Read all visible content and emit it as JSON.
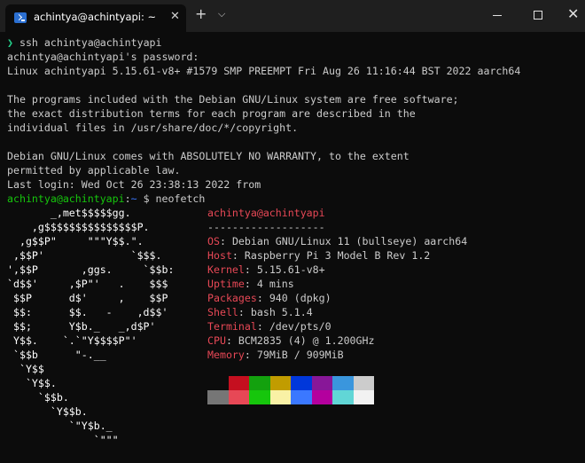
{
  "window": {
    "tab_title": "achintya@achintyapi: ~",
    "tab_close_glyph": "✕",
    "new_tab_glyph": "+",
    "dropdown_glyph": "⌵",
    "close_glyph": "✕"
  },
  "terminal": {
    "prompt_symbol": "❯",
    "ssh_command": "ssh achintya@achintyapi",
    "password_prompt": "achintya@achintyapi's password:",
    "uname": "Linux achintyapi 5.15.61-v8+ #1579 SMP PREEMPT Fri Aug 26 11:16:44 BST 2022 aarch64",
    "motd_lines": [
      "The programs included with the Debian GNU/Linux system are free software;",
      "the exact distribution terms for each program are described in the",
      "individual files in /usr/share/doc/*/copyright.",
      "Debian GNU/Linux comes with ABSOLUTELY NO WARRANTY, to the extent",
      "permitted by applicable law."
    ],
    "last_login": "Last login: Wed Oct 26 23:38:13 2022 from",
    "shell_prompt": {
      "user_host": "achintya@achintyapi",
      "colon": ":",
      "path": "~",
      "dollar": " $ ",
      "command": "neofetch"
    },
    "neofetch": {
      "logo_lines": [
        "       _,met$$$$$gg.",
        "    ,g$$$$$$$$$$$$$$$P.",
        "  ,g$$P\"     \"\"\"Y$$.\".",
        " ,$$P'              `$$$.",
        "',$$P       ,ggs.     `$$b:",
        "`d$$'     ,$P\"'   .    $$$",
        " $$P      d$'     ,    $$P",
        " $$:      $$.   -    ,d$$'",
        " $$;      Y$b._   _,d$P'",
        " Y$$.    `.`\"Y$$$$P\"'",
        " `$$b      \"-.__",
        "  `Y$$",
        "   `Y$$.",
        "     `$$b.",
        "       `Y$$b.",
        "          `\"Y$b._",
        "              `\"\"\""
      ],
      "title": "achintya@achintyapi",
      "separator": "-------------------",
      "fields": [
        {
          "key": "OS",
          "value": "Debian GNU/Linux 11 (bullseye) aarch64"
        },
        {
          "key": "Host",
          "value": "Raspberry Pi 3 Model B Rev 1.2"
        },
        {
          "key": "Kernel",
          "value": "5.15.61-v8+"
        },
        {
          "key": "Uptime",
          "value": "4 mins"
        },
        {
          "key": "Packages",
          "value": "940 (dpkg)"
        },
        {
          "key": "Shell",
          "value": "bash 5.1.4"
        },
        {
          "key": "Terminal",
          "value": "/dev/pts/0"
        },
        {
          "key": "CPU",
          "value": "BCM2835 (4) @ 1.200GHz"
        },
        {
          "key": "Memory",
          "value": "79MiB / 909MiB"
        }
      ],
      "palette_row1": [
        "#0c0c0c",
        "#c50f1f",
        "#13a10e",
        "#c19c00",
        "#0037da",
        "#881798",
        "#3a96dd",
        "#cccccc"
      ],
      "palette_row2": [
        "#767676",
        "#e74856",
        "#16c60c",
        "#f9f1a5",
        "#3b78ff",
        "#b4009e",
        "#61d6d6",
        "#f2f2f2"
      ]
    }
  }
}
